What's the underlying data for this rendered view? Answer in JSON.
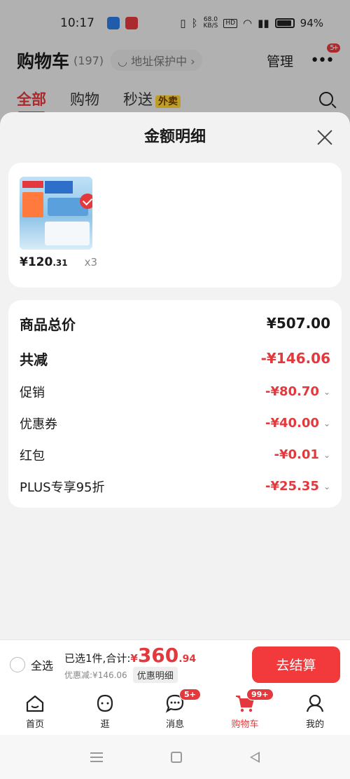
{
  "status": {
    "time": "10:17",
    "net_speed": "68.0",
    "net_unit": "KB/S",
    "hd": "HD",
    "battery": "94%"
  },
  "cart_header": {
    "title": "购物车",
    "count": "(197)",
    "address_chip": "地址保护中",
    "manage": "管理",
    "more_badge": "5+"
  },
  "tabs": [
    {
      "label": "全部"
    },
    {
      "label": "购物"
    },
    {
      "label": "秒送",
      "badge": "外卖"
    }
  ],
  "sheet": {
    "title": "金额明细",
    "product": {
      "price_int": "¥120",
      "price_dec": ".31",
      "qty": "x3"
    },
    "summary": [
      {
        "label": "商品总价",
        "value": "¥507.00"
      },
      {
        "label": "共减",
        "value": "-¥146.06"
      }
    ],
    "discounts": [
      {
        "label": "促销",
        "value": "-¥80.70"
      },
      {
        "label": "优惠券",
        "value": "-¥40.00"
      },
      {
        "label": "红包",
        "value": "-¥0.01"
      },
      {
        "label": "PLUS专享95折",
        "value": "-¥25.35"
      }
    ]
  },
  "checkout": {
    "select_all": "全选",
    "selected_text": "已选1件,合计:",
    "total_yen": "¥",
    "total_int": "360",
    "total_dec": ".94",
    "discount_text": "优惠减:¥146.06",
    "detail_chip": "优惠明细",
    "button": "去结算"
  },
  "tabbar": [
    {
      "label": "首页",
      "icon": "home-icon"
    },
    {
      "label": "逛",
      "icon": "face-icon"
    },
    {
      "label": "消息",
      "icon": "chat-icon",
      "badge": "5+"
    },
    {
      "label": "购物车",
      "icon": "cart-icon",
      "badge": "99+"
    },
    {
      "label": "我的",
      "icon": "profile-icon"
    }
  ],
  "colors": {
    "accent": "#e4393c",
    "button": "#f23a3c"
  }
}
